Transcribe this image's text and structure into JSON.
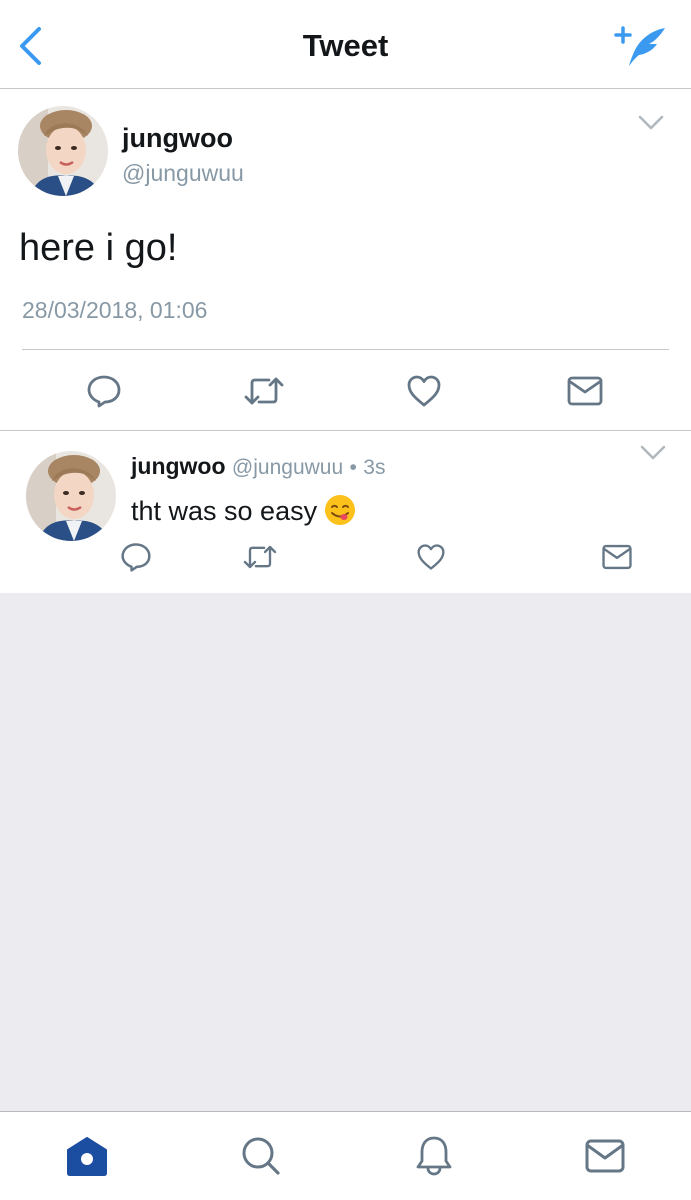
{
  "header": {
    "title": "Tweet",
    "back_icon": "chevron-left-icon",
    "compose_icon": "compose-tweet-icon",
    "accent_color": "#1da1f2"
  },
  "main_tweet": {
    "display_name": "jungwoo",
    "handle": "@junguwuu",
    "text": "here i go!",
    "timestamp": "28/03/2018, 01:06",
    "actions": [
      "reply-icon",
      "retweet-icon",
      "like-icon",
      "dm-icon"
    ]
  },
  "reply_tweet": {
    "display_name": "jungwoo",
    "handle": "@junguwuu",
    "separator": "•",
    "age": "3s",
    "text": "tht was so easy",
    "emoji": "face-savoring-food-emoji",
    "actions": [
      "reply-icon",
      "retweet-icon",
      "like-icon",
      "dm-icon"
    ]
  },
  "tab_bar": {
    "tabs": [
      "home-icon",
      "search-icon",
      "notifications-icon",
      "messages-icon"
    ],
    "active_tab": "home-icon",
    "active_color": "#1b4ea1",
    "inactive_color": "#657786"
  }
}
